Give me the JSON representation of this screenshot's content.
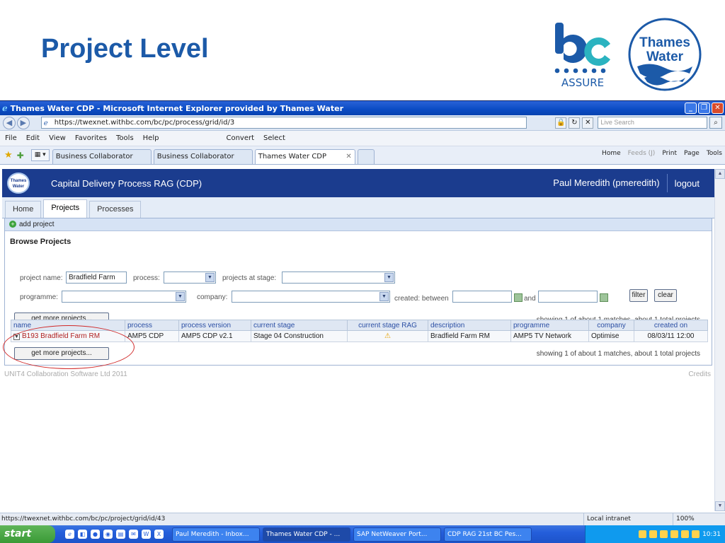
{
  "slide": {
    "title": "Project Level",
    "bc_logo_text": "ASSURE",
    "tw_logo_line1": "Thames",
    "tw_logo_line2": "Water"
  },
  "browser": {
    "window_title": "Thames Water CDP - Microsoft Internet Explorer provided by Thames Water",
    "url": "https://twexnet.withbc.com/bc/pc/process/grid/id/3",
    "live_search_placeholder": "Live Search",
    "menu": [
      "File",
      "Edit",
      "View",
      "Favorites",
      "Tools",
      "Help"
    ],
    "toolbar_convert": "Convert",
    "toolbar_select": "Select",
    "tabs": [
      {
        "label": "Business Collaborator"
      },
      {
        "label": "Business Collaborator"
      },
      {
        "label": "Thames Water CDP"
      }
    ],
    "cmd": {
      "home": "Home",
      "feeds": "Feeds (J)",
      "print": "Print",
      "page": "Page",
      "tools": "Tools"
    },
    "status_url": "https://twexnet.withbc.com/bc/pc/project/grid/id/43",
    "status_zone": "Local intranet",
    "status_zoom": "100%"
  },
  "app": {
    "logo_text": "Thames Water",
    "title": "Capital Delivery Process RAG (CDP)",
    "user": "Paul Meredith (pmeredith)",
    "logout": "logout",
    "tabs": [
      "Home",
      "Projects",
      "Processes"
    ],
    "add_project": "add project",
    "browse_title": "Browse Projects",
    "filters": {
      "project_name_label": "project name:",
      "project_name_value": "Bradfield Farm",
      "process_label": "process:",
      "stage_label": "projects at stage:",
      "programme_label": "programme:",
      "company_label": "company:",
      "created_label": "created: between",
      "and_label": "and",
      "filter_btn": "filter",
      "clear_btn": "clear"
    },
    "get_more": "get more projects...",
    "showing": "showing 1 of about 1 matches, about 1 total projects",
    "columns": [
      "name",
      "process",
      "process version",
      "current stage",
      "current stage RAG",
      "description",
      "programme",
      "company",
      "created on"
    ],
    "rows": [
      {
        "name": "B193 Bradfield Farm RM",
        "process": "AMP5 CDP",
        "version": "AMP5 CDP v2.1",
        "stage": "Stage 04 Construction",
        "rag": "warning",
        "description": "Bradfield Farm RM",
        "programme": "AMP5 TV Network",
        "company": "Optimise",
        "created": "08/03/11 12:00"
      }
    ],
    "copyright": "UNIT4 Collaboration Software Ltd 2011",
    "credits": "Credits"
  },
  "taskbar": {
    "start": "start",
    "tasks": [
      "Paul Meredith - Inbox...",
      "Thames Water CDP - ...",
      "SAP NetWeaver Port...",
      "CDP RAG 21st BC Pes..."
    ],
    "clock": "10:31"
  },
  "colors": {
    "title_blue": "#1c5aa8",
    "app_header": "#1b3c8e",
    "warning": "#e5a000",
    "highlight": "#d02828"
  }
}
